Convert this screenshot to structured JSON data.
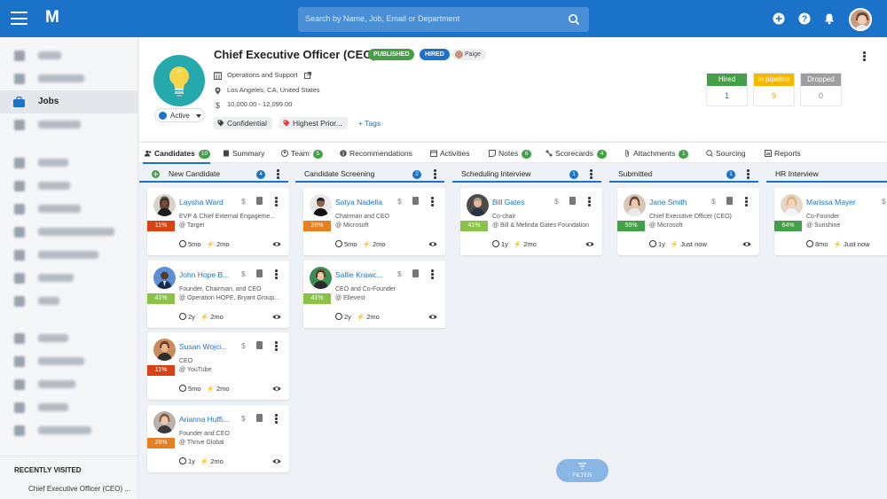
{
  "topbar": {
    "logo": "M",
    "search_placeholder": "Search by Name, Job, Email or Department"
  },
  "sidebar": {
    "active_item": "Jobs",
    "recent_title": "RECENTLY VISITED",
    "recent_item": "Chief Executive Officer (CEO) ..."
  },
  "job": {
    "title": "Chief Executive Officer (CEO)",
    "badge_published": "PUBLISHED",
    "badge_hired": "HIRED",
    "owner": "Paige",
    "department": "Operations and Support",
    "location": "Los Angeles, CA, United States",
    "salary": "10,000.00 - 12,099.00",
    "status": "Active",
    "tags": [
      "Confidential",
      "Highest Prior..."
    ],
    "add_tags": "+ Tags"
  },
  "stats": [
    {
      "label": "Hired",
      "value": "1",
      "color": "#43a047",
      "value_color": "#1a73c9"
    },
    {
      "label": "In pipeline",
      "value": "9",
      "color": "#f5b800",
      "value_color": "#f5a000"
    },
    {
      "label": "Dropped",
      "value": "0",
      "color": "#9e9e9e",
      "value_color": "#888888"
    }
  ],
  "tabs": [
    {
      "label": "Candidates",
      "count": "10"
    },
    {
      "label": "Summary",
      "count": ""
    },
    {
      "label": "Team",
      "count": "5"
    },
    {
      "label": "Recommendations",
      "count": ""
    },
    {
      "label": "Activities",
      "count": ""
    },
    {
      "label": "Notes",
      "count": "6"
    },
    {
      "label": "Scorecards",
      "count": "4"
    },
    {
      "label": "Attachments",
      "count": "1"
    },
    {
      "label": "Sourcing",
      "count": ""
    },
    {
      "label": "Reports",
      "count": ""
    }
  ],
  "columns": [
    {
      "title": "New Candidate",
      "count": "4"
    },
    {
      "title": "Candidate Screening",
      "count": "2"
    },
    {
      "title": "Scheduling Interview",
      "count": "1"
    },
    {
      "title": "Submitted",
      "count": "1"
    },
    {
      "title": "HR Interview",
      "count": ""
    }
  ],
  "cards": [
    {
      "name": "Laysha Ward",
      "score": "11%",
      "score_color": "#d84315",
      "role": "EVP & Chief External Engageme...",
      "company": "@ Target",
      "age": "5mo",
      "activity": "2mo"
    },
    {
      "name": "John Hope B...",
      "score": "41%",
      "score_color": "#8bc34a",
      "role": "Founder, Chairman, and CEO",
      "company": "@ Operation HOPE, Bryant Group...",
      "age": "2y",
      "activity": "2mo"
    },
    {
      "name": "Susan Wojci...",
      "score": "11%",
      "score_color": "#d84315",
      "role": "CEO",
      "company": "@ YouTube",
      "age": "5mo",
      "activity": "2mo"
    },
    {
      "name": "Arianna Huffi...",
      "score": "26%",
      "score_color": "#e67e22",
      "role": "Founder and CEO",
      "company": "@ Thrive Global",
      "age": "1y",
      "activity": "2mo"
    },
    {
      "name": "Satya Nadella",
      "score": "26%",
      "score_color": "#e67e22",
      "role": "Chairman and CEO",
      "company": "@ Microsoft",
      "age": "5mo",
      "activity": "2mo"
    },
    {
      "name": "Sallie Krawc...",
      "score": "41%",
      "score_color": "#8bc34a",
      "role": "CEO and Co-Founder",
      "company": "@ Ellevest",
      "age": "2y",
      "activity": "2mo"
    },
    {
      "name": "Bill Gates",
      "score": "41%",
      "score_color": "#8bc34a",
      "role": "Co-chair",
      "company": "@ Bill & Melinda Gates Foundation",
      "age": "1y",
      "activity": "2mo"
    },
    {
      "name": "Jane Smith",
      "score": "55%",
      "score_color": "#43a047",
      "role": "Chief Executive Officer (CEO)",
      "company": "@ Microsoft",
      "age": "1y",
      "activity": "Just now"
    },
    {
      "name": "Marissa Mayer",
      "score": "64%",
      "score_color": "#43a047",
      "role": "Co-Founder",
      "company": "@ Sunshine",
      "age": "8mo",
      "activity": "Just now"
    }
  ],
  "filter_label": "FILTER",
  "icons": {
    "search": "search-icon",
    "add": "add-circle-icon",
    "help": "help-icon",
    "bell": "bell-icon",
    "dollar": "$",
    "bolt": "⚡"
  }
}
